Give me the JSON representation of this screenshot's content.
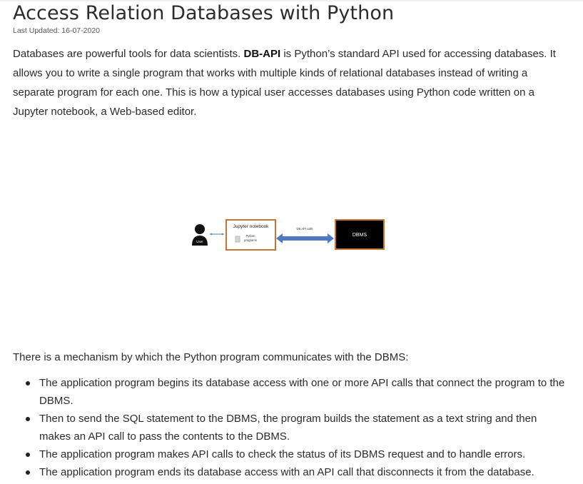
{
  "article": {
    "title": "Access Relation Databases with Python",
    "last_updated": "Last Updated: 16-07-2020",
    "intro": {
      "part1": "Databases are powerful tools for data scientists. ",
      "bold": "DB-API",
      "part2": " is Python’s standard API used for accessing databases. It allows you to write a single program that works with multiple kinds of relational databases instead of writing a separate program for each one. This is how a typical user accesses databases using Python code written on a Jupyter notebook, a Web-based editor."
    },
    "diagram": {
      "user_label": "User",
      "notebook_title": "Jupyter notebook",
      "programs_label_line1": "Python",
      "programs_label_line2": "programs",
      "arrow_label": "DB API calls",
      "dbms_label": "DBMS"
    },
    "mechanism_intro": "There is a mechanism by which the Python program communicates with the DBMS:",
    "steps": [
      "The application program begins its database access with one or more API calls that connect the program to the DBMS.",
      "Then to send the SQL statement to the DBMS, the program builds the statement as a text string and then makes an API call to pass the contents to the DBMS.",
      "The application program makes API calls to check the status of its DBMS request and to handle errors.",
      "The application program ends its database access with an API call that disconnects it from the database."
    ]
  },
  "colors": {
    "box_border": "#c8732f",
    "arrow": "#4f78c4",
    "dbms_fill": "#000000"
  },
  "icons": {
    "user": "person-silhouette-icon",
    "program": "document-icon"
  }
}
